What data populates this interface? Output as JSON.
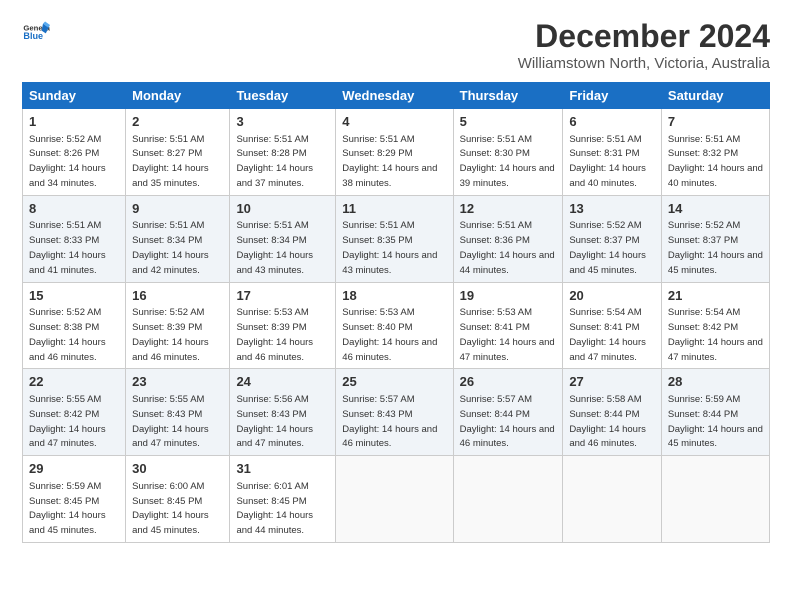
{
  "header": {
    "title": "December 2024",
    "subtitle": "Williamstown North, Victoria, Australia"
  },
  "days_of_week": [
    "Sunday",
    "Monday",
    "Tuesday",
    "Wednesday",
    "Thursday",
    "Friday",
    "Saturday"
  ],
  "weeks": [
    [
      {
        "day": "1",
        "sunrise": "5:52 AM",
        "sunset": "8:26 PM",
        "daylight": "14 hours and 34 minutes."
      },
      {
        "day": "2",
        "sunrise": "5:51 AM",
        "sunset": "8:27 PM",
        "daylight": "14 hours and 35 minutes."
      },
      {
        "day": "3",
        "sunrise": "5:51 AM",
        "sunset": "8:28 PM",
        "daylight": "14 hours and 37 minutes."
      },
      {
        "day": "4",
        "sunrise": "5:51 AM",
        "sunset": "8:29 PM",
        "daylight": "14 hours and 38 minutes."
      },
      {
        "day": "5",
        "sunrise": "5:51 AM",
        "sunset": "8:30 PM",
        "daylight": "14 hours and 39 minutes."
      },
      {
        "day": "6",
        "sunrise": "5:51 AM",
        "sunset": "8:31 PM",
        "daylight": "14 hours and 40 minutes."
      },
      {
        "day": "7",
        "sunrise": "5:51 AM",
        "sunset": "8:32 PM",
        "daylight": "14 hours and 40 minutes."
      }
    ],
    [
      {
        "day": "8",
        "sunrise": "5:51 AM",
        "sunset": "8:33 PM",
        "daylight": "14 hours and 41 minutes."
      },
      {
        "day": "9",
        "sunrise": "5:51 AM",
        "sunset": "8:34 PM",
        "daylight": "14 hours and 42 minutes."
      },
      {
        "day": "10",
        "sunrise": "5:51 AM",
        "sunset": "8:34 PM",
        "daylight": "14 hours and 43 minutes."
      },
      {
        "day": "11",
        "sunrise": "5:51 AM",
        "sunset": "8:35 PM",
        "daylight": "14 hours and 43 minutes."
      },
      {
        "day": "12",
        "sunrise": "5:51 AM",
        "sunset": "8:36 PM",
        "daylight": "14 hours and 44 minutes."
      },
      {
        "day": "13",
        "sunrise": "5:52 AM",
        "sunset": "8:37 PM",
        "daylight": "14 hours and 45 minutes."
      },
      {
        "day": "14",
        "sunrise": "5:52 AM",
        "sunset": "8:37 PM",
        "daylight": "14 hours and 45 minutes."
      }
    ],
    [
      {
        "day": "15",
        "sunrise": "5:52 AM",
        "sunset": "8:38 PM",
        "daylight": "14 hours and 46 minutes."
      },
      {
        "day": "16",
        "sunrise": "5:52 AM",
        "sunset": "8:39 PM",
        "daylight": "14 hours and 46 minutes."
      },
      {
        "day": "17",
        "sunrise": "5:53 AM",
        "sunset": "8:39 PM",
        "daylight": "14 hours and 46 minutes."
      },
      {
        "day": "18",
        "sunrise": "5:53 AM",
        "sunset": "8:40 PM",
        "daylight": "14 hours and 46 minutes."
      },
      {
        "day": "19",
        "sunrise": "5:53 AM",
        "sunset": "8:41 PM",
        "daylight": "14 hours and 47 minutes."
      },
      {
        "day": "20",
        "sunrise": "5:54 AM",
        "sunset": "8:41 PM",
        "daylight": "14 hours and 47 minutes."
      },
      {
        "day": "21",
        "sunrise": "5:54 AM",
        "sunset": "8:42 PM",
        "daylight": "14 hours and 47 minutes."
      }
    ],
    [
      {
        "day": "22",
        "sunrise": "5:55 AM",
        "sunset": "8:42 PM",
        "daylight": "14 hours and 47 minutes."
      },
      {
        "day": "23",
        "sunrise": "5:55 AM",
        "sunset": "8:43 PM",
        "daylight": "14 hours and 47 minutes."
      },
      {
        "day": "24",
        "sunrise": "5:56 AM",
        "sunset": "8:43 PM",
        "daylight": "14 hours and 47 minutes."
      },
      {
        "day": "25",
        "sunrise": "5:57 AM",
        "sunset": "8:43 PM",
        "daylight": "14 hours and 46 minutes."
      },
      {
        "day": "26",
        "sunrise": "5:57 AM",
        "sunset": "8:44 PM",
        "daylight": "14 hours and 46 minutes."
      },
      {
        "day": "27",
        "sunrise": "5:58 AM",
        "sunset": "8:44 PM",
        "daylight": "14 hours and 46 minutes."
      },
      {
        "day": "28",
        "sunrise": "5:59 AM",
        "sunset": "8:44 PM",
        "daylight": "14 hours and 45 minutes."
      }
    ],
    [
      {
        "day": "29",
        "sunrise": "5:59 AM",
        "sunset": "8:45 PM",
        "daylight": "14 hours and 45 minutes."
      },
      {
        "day": "30",
        "sunrise": "6:00 AM",
        "sunset": "8:45 PM",
        "daylight": "14 hours and 45 minutes."
      },
      {
        "day": "31",
        "sunrise": "6:01 AM",
        "sunset": "8:45 PM",
        "daylight": "14 hours and 44 minutes."
      },
      null,
      null,
      null,
      null
    ]
  ]
}
